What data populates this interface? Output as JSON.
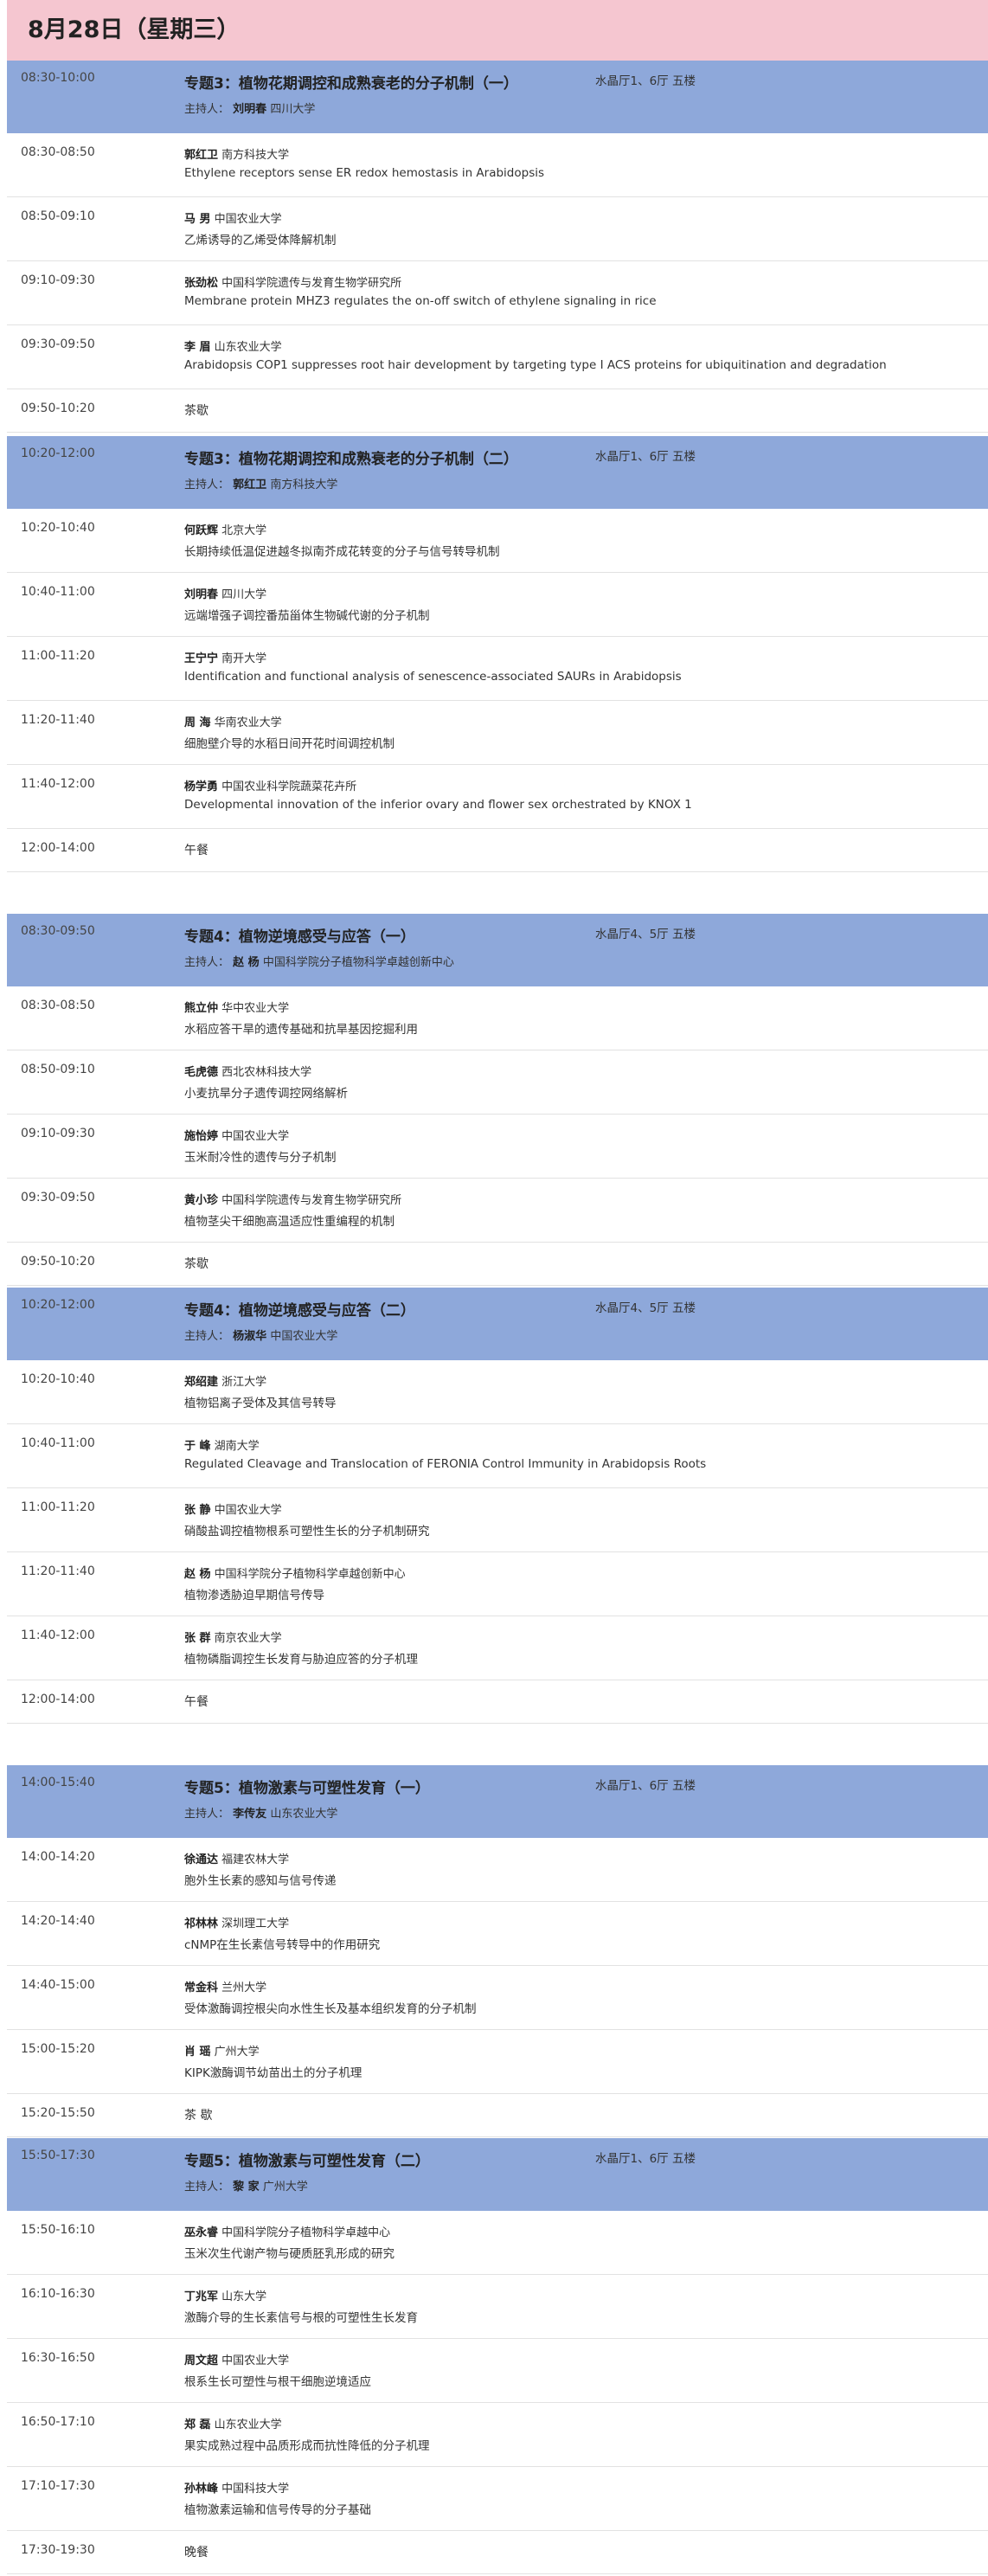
{
  "page_title": "8月28日（星期三）",
  "host_label": "主持人：",
  "sessions": [
    {
      "time": "08:30-10:00",
      "title": "专题3：植物花期调控和成熟衰老的分子机制（一）",
      "venue": "水晶厅1、6厅 五楼",
      "host_name": "刘明春",
      "host_affil": "四川大学",
      "items": [
        {
          "time": "08:30-08:50",
          "speaker": "郭红卫",
          "affil": "南方科技大学",
          "title": "Ethylene receptors sense ER redox hemostasis in Arabidopsis"
        },
        {
          "time": "08:50-09:10",
          "speaker": "马 男",
          "affil": "中国农业大学",
          "title": "乙烯诱导的乙烯受体降解机制"
        },
        {
          "time": "09:10-09:30",
          "speaker": "张劲松",
          "affil": "中国科学院遗传与发育生物学研究所",
          "title": "Membrane protein MHZ3 regulates the on-off switch of ethylene signaling in rice"
        },
        {
          "time": "09:30-09:50",
          "speaker": "李 眉",
          "affil": "山东农业大学",
          "title": "Arabidopsis COP1 suppresses root hair development by targeting type I ACS proteins for ubiquitination and degradation"
        }
      ],
      "break": {
        "time": "09:50-10:20",
        "text": "茶歇"
      }
    },
    {
      "time": "10:20-12:00",
      "title": "专题3：植物花期调控和成熟衰老的分子机制（二）",
      "venue": "水晶厅1、6厅 五楼",
      "host_name": "郭红卫",
      "host_affil": "南方科技大学",
      "items": [
        {
          "time": "10:20-10:40",
          "speaker": "何跃辉",
          "affil": "北京大学",
          "title": "长期持续低温促进越冬拟南芥成花转变的分子与信号转导机制"
        },
        {
          "time": "10:40-11:00",
          "speaker": "刘明春",
          "affil": "四川大学",
          "title": "远端增强子调控番茄甾体生物碱代谢的分子机制"
        },
        {
          "time": "11:00-11:20",
          "speaker": "王宁宁",
          "affil": "南开大学",
          "title": "Identification and functional analysis of senescence-associated SAURs in Arabidopsis"
        },
        {
          "time": "11:20-11:40",
          "speaker": "周 海",
          "affil": "华南农业大学",
          "title": "细胞壁介导的水稻日间开花时间调控机制"
        },
        {
          "time": "11:40-12:00",
          "speaker": "杨学勇",
          "affil": "中国农业科学院蔬菜花卉所",
          "title": "Developmental innovation of the inferior ovary and flower sex orchestrated by KNOX 1"
        }
      ],
      "break": {
        "time": "12:00-14:00",
        "text": "午餐"
      }
    },
    {
      "time": "08:30-09:50",
      "title": "专题4：植物逆境感受与应答（一）",
      "venue": "水晶厅4、5厅 五楼",
      "host_name": "赵 杨",
      "host_affil": "中国科学院分子植物科学卓越创新中心",
      "items": [
        {
          "time": "08:30-08:50",
          "speaker": "熊立仲",
          "affil": "华中农业大学",
          "title": "水稻应答干旱的遗传基础和抗旱基因挖掘利用"
        },
        {
          "time": "08:50-09:10",
          "speaker": "毛虎德",
          "affil": "西北农林科技大学",
          "title": "小麦抗旱分子遗传调控网络解析"
        },
        {
          "time": "09:10-09:30",
          "speaker": "施怡婷",
          "affil": "中国农业大学",
          "title": "玉米耐冷性的遗传与分子机制"
        },
        {
          "time": "09:30-09:50",
          "speaker": "黄小珍",
          "affil": "中国科学院遗传与发育生物学研究所",
          "title": "植物茎尖干细胞高温适应性重编程的机制"
        }
      ],
      "break": {
        "time": "09:50-10:20",
        "text": "茶歇"
      }
    },
    {
      "time": "10:20-12:00",
      "title": "专题4：植物逆境感受与应答（二）",
      "venue": "水晶厅4、5厅 五楼",
      "host_name": "杨淑华",
      "host_affil": "中国农业大学",
      "items": [
        {
          "time": "10:20-10:40",
          "speaker": "郑绍建",
          "affil": "浙江大学",
          "title": "植物铝离子受体及其信号转导"
        },
        {
          "time": "10:40-11:00",
          "speaker": "于 峰",
          "affil": "湖南大学",
          "title": "Regulated Cleavage and Translocation of FERONIA Control Immunity in Arabidopsis Roots"
        },
        {
          "time": "11:00-11:20",
          "speaker": "张 静",
          "affil": "中国农业大学",
          "title": "硝酸盐调控植物根系可塑性生长的分子机制研究"
        },
        {
          "time": "11:20-11:40",
          "speaker": "赵 杨",
          "affil": "中国科学院分子植物科学卓越创新中心",
          "title": "植物渗透胁迫早期信号传导"
        },
        {
          "time": "11:40-12:00",
          "speaker": "张 群",
          "affil": "南京农业大学",
          "title": "植物磷脂调控生长发育与胁迫应答的分子机理"
        }
      ],
      "break": {
        "time": "12:00-14:00",
        "text": "午餐"
      }
    },
    {
      "time": "14:00-15:40",
      "title": "专题5：植物激素与可塑性发育（一）",
      "venue": "水晶厅1、6厅 五楼",
      "host_name": "李传友",
      "host_affil": "山东农业大学",
      "items": [
        {
          "time": "14:00-14:20",
          "speaker": "徐通达",
          "affil": "福建农林大学",
          "title": "胞外生长素的感知与信号传递"
        },
        {
          "time": "14:20-14:40",
          "speaker": "祁林林",
          "affil": "深圳理工大学",
          "title": "cNMP在生长素信号转导中的作用研究"
        },
        {
          "time": "14:40-15:00",
          "speaker": "常金科",
          "affil": "兰州大学",
          "title": "受体激酶调控根尖向水性生长及基本组织发育的分子机制"
        },
        {
          "time": "15:00-15:20",
          "speaker": "肖 瑶",
          "affil": "广州大学",
          "title": "KIPK激酶调节幼苗出土的分子机理"
        }
      ],
      "break": {
        "time": "15:20-15:50",
        "text": "茶 歇"
      }
    },
    {
      "time": "15:50-17:30",
      "title": "专题5：植物激素与可塑性发育（二）",
      "venue": "水晶厅1、6厅 五楼",
      "host_name": "黎 家",
      "host_affil": "广州大学",
      "items": [
        {
          "time": "15:50-16:10",
          "speaker": "巫永睿",
          "affil": "中国科学院分子植物科学卓越中心",
          "title": "玉米次生代谢产物与硬质胚乳形成的研究"
        },
        {
          "time": "16:10-16:30",
          "speaker": "丁兆军",
          "affil": "山东大学",
          "title": "激酶介导的生长素信号与根的可塑性生长发育"
        },
        {
          "time": "16:30-16:50",
          "speaker": "周文超",
          "affil": "中国农业大学",
          "title": "根系生长可塑性与根干细胞逆境适应"
        },
        {
          "time": "16:50-17:10",
          "speaker": "郑 磊",
          "affil": "山东农业大学",
          "title": "果实成熟过程中品质形成而抗性降低的分子机理"
        },
        {
          "time": "17:10-17:30",
          "speaker": "孙林峰",
          "affil": "中国科技大学",
          "title": "植物激素运输和信号传导的分子基础"
        }
      ],
      "break": {
        "time": "17:30-19:30",
        "text": "晚餐"
      }
    }
  ]
}
